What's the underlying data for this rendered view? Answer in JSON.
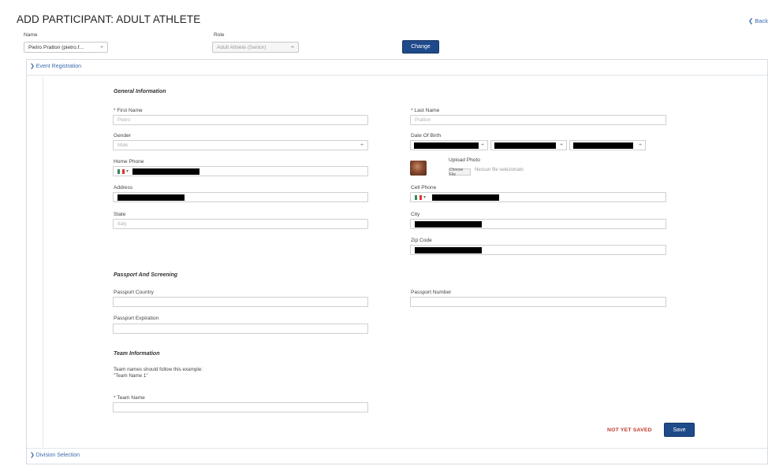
{
  "header": {
    "title": "ADD PARTICIPANT: ADULT ATHLETE",
    "back_label": "❮ Back"
  },
  "top_form": {
    "name_label": "Name",
    "name_value": "Pietro Pratton (pietro.f...",
    "role_label": "Role",
    "role_value": "Adult Athlete (Senior)",
    "change_label": "Change"
  },
  "sections": {
    "event_registration": "❯ Event Registration",
    "division_selection": "❯ Division Selection"
  },
  "general": {
    "title": "General Information",
    "first_name_label": "* First Name",
    "first_name_value": "Pietro",
    "last_name_label": "* Last Name",
    "last_name_value": "Pratton",
    "gender_label": "Gender",
    "gender_value": "Male",
    "dob_label": "Date Of Birth",
    "home_phone_label": "Home Phone",
    "upload_photo_label": "Upload Photo",
    "choose_file_label": "Choose File",
    "no_file_label": "Nessun file selezionato",
    "address_label": "Address",
    "cell_phone_label": "Cell Phone",
    "state_label": "State",
    "state_value": "Italy",
    "city_label": "City",
    "zip_label": "Zip Code"
  },
  "passport": {
    "title": "Passport And Screening",
    "country_label": "Passport Country",
    "number_label": "Passport Number",
    "expiration_label": "Passport Expiration"
  },
  "team": {
    "title": "Team Information",
    "note_line1": "Team names should follow this example:",
    "note_line2": "\"Team Name 1\"",
    "team_name_label": "* Team Name"
  },
  "footer": {
    "status_text": "NOT YET SAVED",
    "save_label": "Save"
  },
  "colors": {
    "accent": "#1f4a8a",
    "link": "#3a6ab0",
    "warning": "#c0392b"
  },
  "icons": {
    "flag": "italy-flag-icon",
    "chevron": "chevron-right-icon",
    "select": "select-arrows-icon"
  }
}
